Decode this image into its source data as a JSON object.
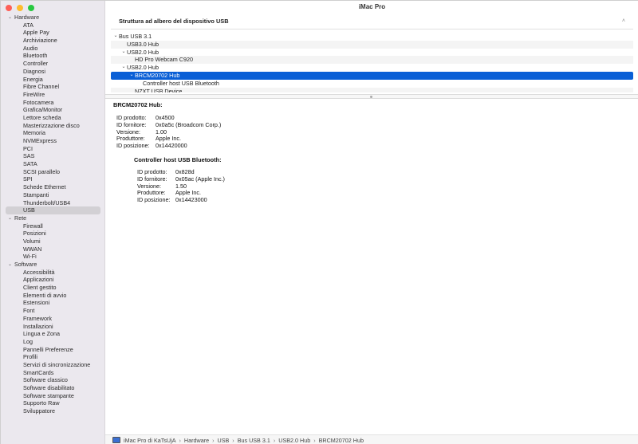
{
  "window": {
    "title": "iMac Pro"
  },
  "sidebar": {
    "categories": [
      {
        "label": "Hardware",
        "items": [
          "ATA",
          "Apple Pay",
          "Archiviazione",
          "Audio",
          "Bluetooth",
          "Controller",
          "Diagnosi",
          "Energia",
          "Fibre Channel",
          "FireWire",
          "Fotocamera",
          "Grafica/Monitor",
          "Lettore scheda",
          "Masterizzazione disco",
          "Memoria",
          "NVMExpress",
          "PCI",
          "SAS",
          "SATA",
          "SCSI parallelo",
          "SPI",
          "Schede Ethernet",
          "Stampanti",
          "Thunderbolt/USB4",
          "USB"
        ]
      },
      {
        "label": "Rete",
        "items": [
          "Firewall",
          "Posizioni",
          "Volumi",
          "WWAN",
          "Wi-Fi"
        ]
      },
      {
        "label": "Software",
        "items": [
          "Accessibilità",
          "Applicazioni",
          "Client gestito",
          "Elementi di avvio",
          "Estensioni",
          "Font",
          "Framework",
          "Installazioni",
          "Lingua e Zona",
          "Log",
          "Pannelli Preferenze",
          "Profili",
          "Servizi di sincronizzazione",
          "SmartCards",
          "Software classico",
          "Software disabilitato",
          "Software stampante",
          "Supporto Raw",
          "Sviluppatore"
        ]
      }
    ],
    "selected_item": "USB"
  },
  "main": {
    "section_header": "Struttura ad albero del dispositivo USB",
    "tree": [
      {
        "label": "Bus USB 3.1",
        "expandable": true
      },
      {
        "label": "USB3.0 Hub",
        "expandable": false
      },
      {
        "label": "USB2.0 Hub",
        "expandable": true
      },
      {
        "label": "HD Pro Webcam C920",
        "expandable": false
      },
      {
        "label": "USB2.0 Hub",
        "expandable": true
      },
      {
        "label": "BRCM20702 Hub",
        "expandable": true,
        "selected": true
      },
      {
        "label": "Controller host USB Bluetooth",
        "expandable": false
      },
      {
        "label": "NZXT USB Device",
        "expandable": false
      }
    ],
    "detail": {
      "title": "BRCM20702 Hub:",
      "fields": [
        {
          "k": "ID prodotto:",
          "v": "0x4500"
        },
        {
          "k": "ID fornitore:",
          "v": "0x0a5c  (Broadcom Corp.)"
        },
        {
          "k": "Versione:",
          "v": "1.00"
        },
        {
          "k": "Produttore:",
          "v": "Apple Inc."
        },
        {
          "k": "ID posizione:",
          "v": "0x14420000"
        }
      ],
      "child": {
        "title": "Controller host USB Bluetooth:",
        "fields": [
          {
            "k": "ID prodotto:",
            "v": "0x828d"
          },
          {
            "k": "ID fornitore:",
            "v": "0x05ac  (Apple Inc.)"
          },
          {
            "k": "Versione:",
            "v": "1.50"
          },
          {
            "k": "Produttore:",
            "v": "Apple Inc."
          },
          {
            "k": "ID posizione:",
            "v": "0x14423000"
          }
        ]
      }
    }
  },
  "statusbar": {
    "path": [
      "iMac Pro di KaTsUjA",
      "Hardware",
      "USB",
      "Bus USB 3.1",
      "USB2.0 Hub",
      "BRCM20702 Hub"
    ],
    "separator": "›"
  },
  "colors": {
    "accent": "#0a5fd6",
    "sidebar_bg": "#ebe8ee"
  },
  "icons": {
    "expand": "chevron-down-icon",
    "computer": "imac-icon"
  }
}
